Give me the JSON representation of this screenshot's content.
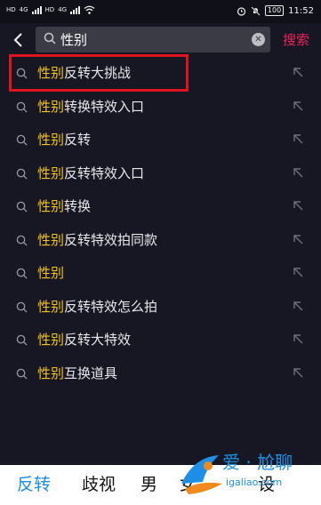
{
  "status_bar": {
    "left_labels": [
      "HD",
      "4G",
      "HD",
      "4G"
    ],
    "battery": "100",
    "time": "11:52"
  },
  "search": {
    "query": "性别",
    "submit_label": "搜索"
  },
  "suggestions": [
    {
      "highlight": "性别",
      "rest": "反转大挑战"
    },
    {
      "highlight": "性别",
      "rest": "转换特效入口"
    },
    {
      "highlight": "性别",
      "rest": "反转"
    },
    {
      "highlight": "性别",
      "rest": "反转特效入口"
    },
    {
      "highlight": "性别",
      "rest": "转换"
    },
    {
      "highlight": "性别",
      "rest": "反转特效拍同款"
    },
    {
      "highlight": "性别",
      "rest": ""
    },
    {
      "highlight": "性别",
      "rest": "反转特效怎么拍"
    },
    {
      "highlight": "性别",
      "rest": "反转大特效"
    },
    {
      "highlight": "性别",
      "rest": "互换道具"
    }
  ],
  "keyboard_candidates": [
    "反转",
    "歧视",
    "男",
    "女",
    "设"
  ],
  "watermark": {
    "text": "爱 · 尬聊",
    "url": "igaliao.com"
  },
  "colors": {
    "background": "#161722",
    "highlight": "#f5c518",
    "search_button": "#f0205a",
    "annotation_box": "#e0141e",
    "active_candidate": "#1c8fe6"
  }
}
